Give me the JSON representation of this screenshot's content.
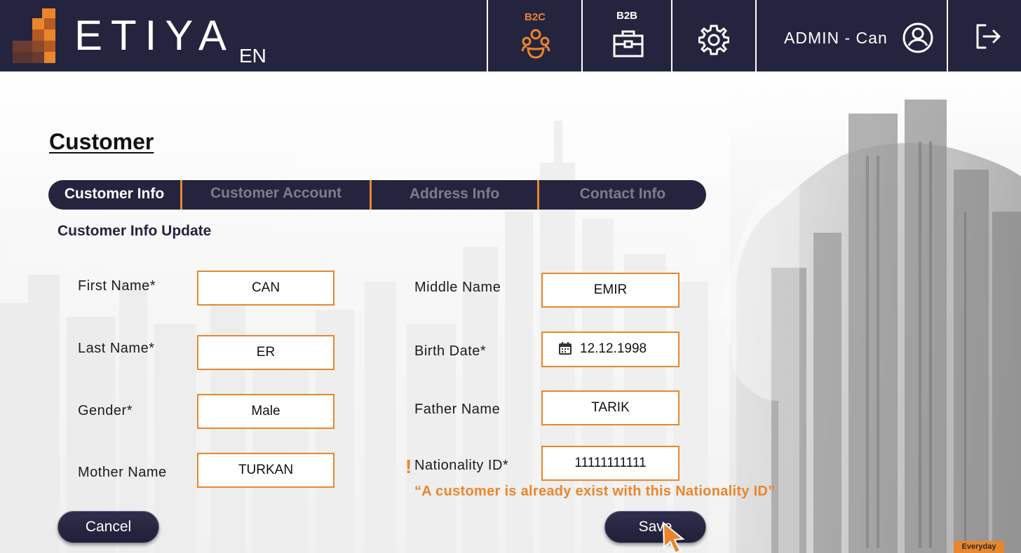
{
  "header": {
    "logo_text": "ETIYA",
    "language": "EN",
    "b2c_label": "B2C",
    "b2b_label": "B2B",
    "user_label": "ADMIN - Can"
  },
  "colors": {
    "navy": "#25243f",
    "accent": "#e9862c",
    "tab_inactive": "#7c7d8b"
  },
  "icons": {
    "b2c": "people-group-icon",
    "b2b": "briefcase-icon",
    "settings": "gear-icon",
    "user": "user-circle-icon",
    "logout": "logout-icon",
    "date": "calendar-icon",
    "warning": "exclamation-icon"
  },
  "page": {
    "title": "Customer"
  },
  "tabs": {
    "customer_info": "Customer Info",
    "customer_account": "Customer Account",
    "address_info": "Address Info",
    "contact_info": "Contact Info"
  },
  "form": {
    "section_title": "Customer Info Update",
    "first_name": {
      "label": "First Name*",
      "value": "CAN"
    },
    "last_name": {
      "label": "Last Name*",
      "value": "ER"
    },
    "gender": {
      "label": "Gender*",
      "value": "Male"
    },
    "mother_name": {
      "label": "Mother Name",
      "value": "TURKAN"
    },
    "middle_name": {
      "label": "Middle Name",
      "value": "EMIR"
    },
    "birth_date": {
      "label": "Birth Date*",
      "value": "12.12.1998"
    },
    "father_name": {
      "label": "Father Name",
      "value": "TARIK"
    },
    "nationality_id": {
      "label": "Nationality ID*",
      "value": "11111111111"
    },
    "warning_mark": "!",
    "error_message": "“A customer is already exist with this Nationality ID”"
  },
  "actions": {
    "cancel": "Cancel",
    "save": "Save"
  },
  "corner_badge": "Everyday"
}
